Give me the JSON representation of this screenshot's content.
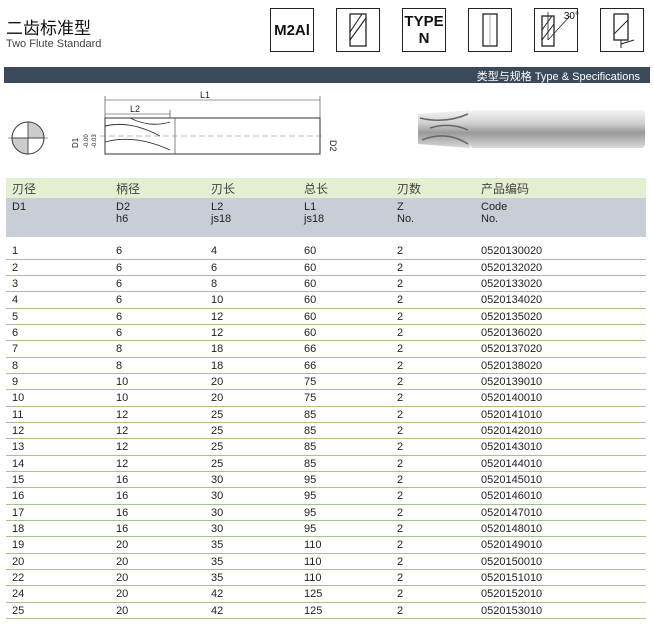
{
  "header": {
    "title_cn": "二齿标准型",
    "title_en": "Two Flute Standard",
    "badges": {
      "material": "M2Al",
      "type_line1": "TYPE",
      "type_line2": "N",
      "angle": "30°"
    }
  },
  "spec_bar": {
    "label": "类型与规格  Type & Specifications"
  },
  "diagram": {
    "l1": "L1",
    "l2": "L2",
    "d2": "D2",
    "d1": "D1",
    "tol_top": "-0.00",
    "tol_bottom": "-0.03"
  },
  "table": {
    "header_cn": [
      "刃径",
      "柄径",
      "刃长",
      "总长",
      "刃数",
      "产品编码"
    ],
    "header_en": [
      "D1",
      "D2",
      "L2",
      "L1",
      "Z",
      "Code"
    ],
    "header_sub": [
      "",
      "h6",
      "js18",
      "js18",
      "No.",
      "No."
    ],
    "rows": [
      [
        "1",
        "6",
        "4",
        "60",
        "2",
        "0520130020"
      ],
      [
        "2",
        "6",
        "6",
        "60",
        "2",
        "0520132020"
      ],
      [
        "3",
        "6",
        "8",
        "60",
        "2",
        "0520133020"
      ],
      [
        "4",
        "6",
        "10",
        "60",
        "2",
        "0520134020"
      ],
      [
        "5",
        "6",
        "12",
        "60",
        "2",
        "0520135020"
      ],
      [
        "6",
        "6",
        "12",
        "60",
        "2",
        "0520136020"
      ],
      [
        "7",
        "8",
        "18",
        "66",
        "2",
        "0520137020"
      ],
      [
        "8",
        "8",
        "18",
        "66",
        "2",
        "0520138020"
      ],
      [
        "9",
        "10",
        "20",
        "75",
        "2",
        "0520139010"
      ],
      [
        "10",
        "10",
        "20",
        "75",
        "2",
        "0520140010"
      ],
      [
        "11",
        "12",
        "25",
        "85",
        "2",
        "0520141010"
      ],
      [
        "12",
        "12",
        "25",
        "85",
        "2",
        "0520142010"
      ],
      [
        "13",
        "12",
        "25",
        "85",
        "2",
        "0520143010"
      ],
      [
        "14",
        "12",
        "25",
        "85",
        "2",
        "0520144010"
      ],
      [
        "15",
        "16",
        "30",
        "95",
        "2",
        "0520145010"
      ],
      [
        "16",
        "16",
        "30",
        "95",
        "2",
        "0520146010"
      ],
      [
        "17",
        "16",
        "30",
        "95",
        "2",
        "0520147010"
      ],
      [
        "18",
        "16",
        "30",
        "95",
        "2",
        "0520148010"
      ],
      [
        "19",
        "20",
        "35",
        "110",
        "2",
        "0520149010"
      ],
      [
        "20",
        "20",
        "35",
        "110",
        "2",
        "0520150010"
      ],
      [
        "22",
        "20",
        "35",
        "110",
        "2",
        "0520151010"
      ],
      [
        "24",
        "20",
        "42",
        "125",
        "2",
        "0520152010"
      ],
      [
        "25",
        "20",
        "42",
        "125",
        "2",
        "0520153010"
      ]
    ]
  }
}
